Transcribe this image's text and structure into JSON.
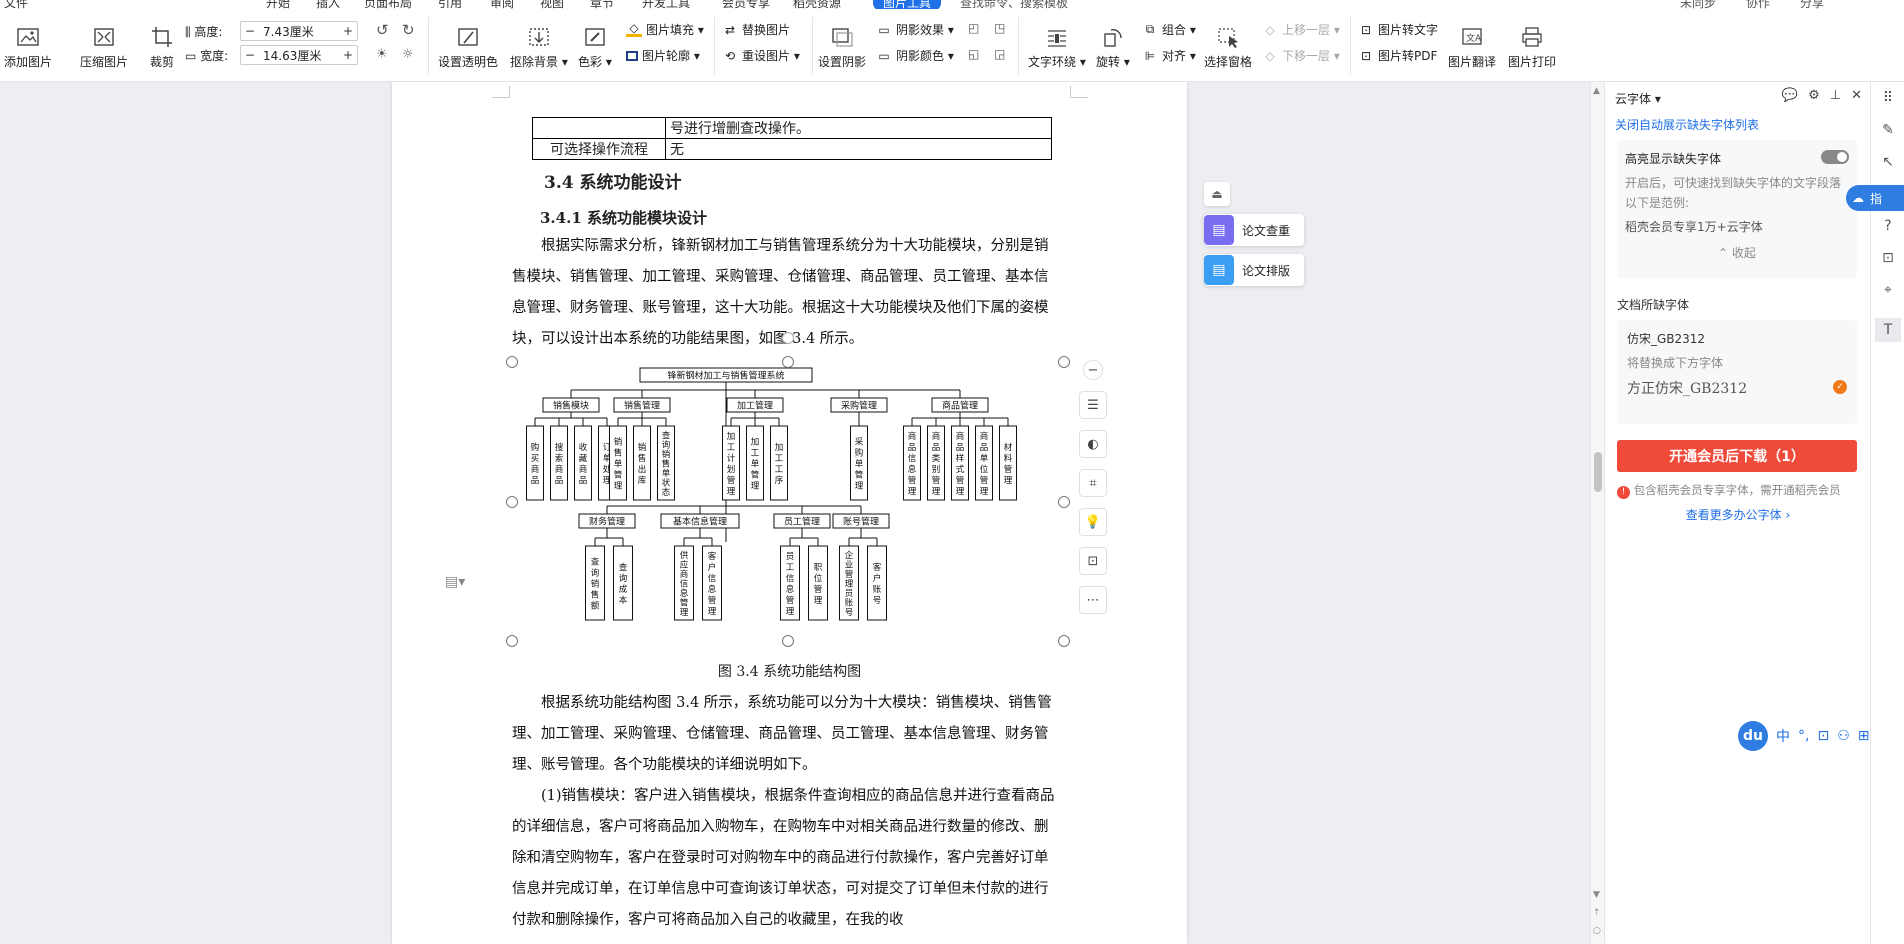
{
  "menu": {
    "items": [
      "文件",
      "开始",
      "插入",
      "页面布局",
      "引用",
      "审阅",
      "视图",
      "章节",
      "开发工具",
      "会员专享",
      "稻壳资源",
      "图片工具"
    ],
    "active": "图片工具",
    "search": "查找命令、搜索模板",
    "right": [
      "未同步",
      "协作",
      "分享"
    ]
  },
  "ribbon": {
    "add_picture": "添加图片",
    "compress": "压缩图片",
    "crop": "裁剪",
    "height_label": "高度:",
    "height_value": "7.43厘米",
    "width_label": "宽度:",
    "width_value": "14.63厘米",
    "minus": "−",
    "plus": "+",
    "set_transparent": "设置透明色",
    "remove_bg": "抠除背景",
    "color": "色彩",
    "fill": "图片填充",
    "outline": "图片轮廓",
    "replace": "替换图片",
    "reset": "重设图片",
    "set_shadow": "设置阴影",
    "shadow_effect": "阴影效果",
    "shadow_color": "阴影颜色",
    "text_wrap": "文字环绕",
    "rotate": "旋转",
    "group": "组合",
    "align": "对齐",
    "select_pane": "选择窗格",
    "bring_forward": "上移一层",
    "send_backward": "下移一层",
    "pic_to_text": "图片转文字",
    "pic_to_pdf": "图片转PDF",
    "pic_translate": "图片翻译",
    "pic_print": "图片打印"
  },
  "document": {
    "table_rows": [
      [
        "",
        "号进行增删查改操作。"
      ],
      [
        "可选择操作流程",
        "无"
      ]
    ],
    "heading2": "3.4  系统功能设计",
    "heading3": "3.4.1  系统功能模块设计",
    "para1": "根据实际需求分析，锋新钢材加工与销售管理系统分为十大功能模块，分别是销售模块、销售管理、加工管理、采购管理、仓储管理、商品管理、员工管理、基本信息管理、财务管理、账号管理，这十大功能。根据这十大功能模块及他们下属的姿模块，可以设计出本系统的功能结果图，如图 3.4 所示。",
    "caption": "图 3.4 系统功能结构图",
    "para2": "根据系统功能结构图 3.4 所示，系统功能可以分为十大模块：销售模块、销售管理、加工管理、采购管理、仓储管理、商品管理、员工管理、基本信息管理、财务管理、账号管理。各个功能模块的详细说明如下。",
    "para3": "(1)销售模块：客户进入销售模块，根据条件查询相应的商品信息并进行查看商品的详细信息，客户可将商品加入购物车，在购物车中对相关商品进行数量的修改、删除和清空购物车，客户在登录时可对购物车中的商品进行付款操作，客户完善好订单信息并完成订单，在订单信息中可查询该订单状态，可对提交了订单但未付款的进行付款和删除操作，客户可将商品加入自己的收藏里，在我的收"
  },
  "diagram": {
    "root": "锋新钢材加工与销售管理系统",
    "row1": [
      {
        "name": "销售模块",
        "children": [
          "购买商品",
          "搜索商品",
          "收藏商品",
          "订单处理"
        ]
      },
      {
        "name": "销售管理",
        "children": [
          "销售单管理",
          "销售出库",
          "查询销售单状态"
        ]
      },
      {
        "name": "加工管理",
        "children": [
          "加工计划管理",
          "加工单管理",
          "加工工序"
        ]
      },
      {
        "name": "采购管理",
        "children": [
          "采购单管理"
        ]
      },
      {
        "name": "商品管理",
        "children": [
          "商品信息管理",
          "商品类别管理",
          "商品样式管理",
          "商品单位管理",
          "材料管理"
        ]
      }
    ],
    "row2": [
      {
        "name": "财务管理",
        "children": [
          "查询销售额",
          "查询成本"
        ]
      },
      {
        "name": "基本信息管理",
        "children": [
          "供应商信息管理",
          "客户信息管理"
        ]
      },
      {
        "name": "员工管理",
        "children": [
          "员工信息管理",
          "职位管理"
        ]
      },
      {
        "name": "账号管理",
        "children": [
          "企业管理员账号",
          "客户账号"
        ]
      }
    ]
  },
  "side_float": {
    "paper_check": "论文查重",
    "paper_layout": "论文排版"
  },
  "panel": {
    "title": "云字体",
    "close_auto": "关闭自动展示缺失字体列表",
    "highlight_title": "高亮显示缺失字体",
    "highlight_desc": "开启后，可快速找到缺失字体的文字段落",
    "example_label": "以下是范例:",
    "example_text": "稻壳会员专享1万+云字体",
    "collapse": "收起",
    "missing_title": "文档所缺字体",
    "font_name": "仿宋_GB2312",
    "replace_hint": "将替换成下方字体",
    "replaced_font": "方正仿宋_GB2312",
    "download_btn": "开通会员后下载（1）",
    "member_note": "包含稻壳会员专享字体，需开通稻壳会员",
    "more_link": "查看更多办公字体"
  },
  "ime": {
    "logo": "du",
    "items": [
      "中",
      "°,",
      "⊡",
      "⚇",
      "⊞"
    ]
  },
  "cloud_tab": "指",
  "colors": {
    "accent": "#1f6fe5",
    "danger": "#ef4a3a",
    "float_purple": "#7a6ef0",
    "float_blue": "#3c9ef2"
  }
}
